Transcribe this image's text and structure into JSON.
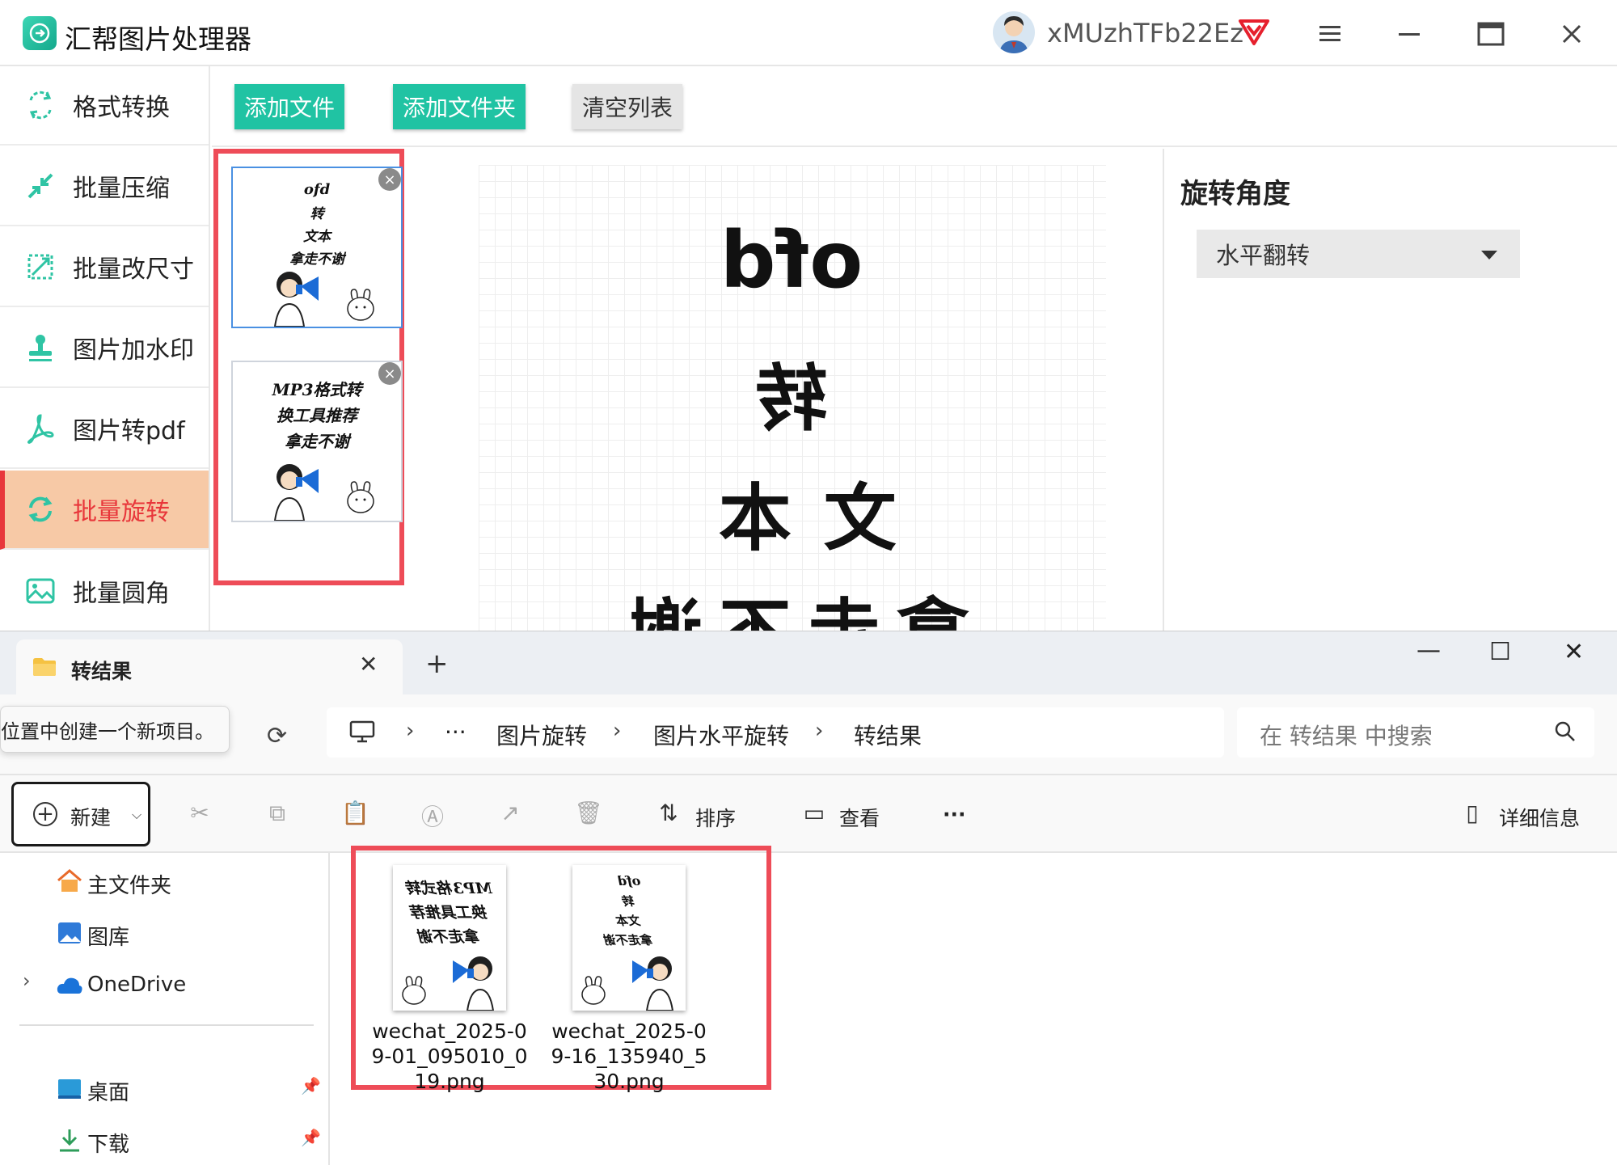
{
  "app": {
    "title": "汇帮图片处理器",
    "user_name": "xMUzhTFb22Ez",
    "buttons": {
      "add_file": "添加文件",
      "add_folder": "添加文件夹",
      "clear_list": "清空列表"
    },
    "sidebar": [
      {
        "label": "格式转换",
        "icon": "format-convert-icon"
      },
      {
        "label": "批量压缩",
        "icon": "compress-icon"
      },
      {
        "label": "批量改尺寸",
        "icon": "resize-icon"
      },
      {
        "label": "图片加水印",
        "icon": "watermark-icon"
      },
      {
        "label": "图片转pdf",
        "icon": "pdf-icon"
      },
      {
        "label": "批量旋转",
        "icon": "rotate-icon",
        "active": true
      },
      {
        "label": "批量圆角",
        "icon": "rounded-corner-icon"
      }
    ],
    "thumbnails": [
      {
        "lines": [
          "ofd",
          "转",
          "文本",
          "拿走不谢"
        ]
      },
      {
        "lines": [
          "MP3格式转",
          "换工具推荐",
          "拿走不谢"
        ]
      }
    ],
    "preview": {
      "lines": [
        "ofd",
        "转",
        "文本",
        "拿走不谢"
      ]
    },
    "rotate": {
      "label": "旋转角度",
      "selected": "水平翻转"
    },
    "accent": "#20c3a3",
    "active_color": "#e8373b",
    "highlight_border": "#ee4c58"
  },
  "explorer": {
    "tab_title": "转结果",
    "tooltip": "位置中创建一个新项目。",
    "breadcrumb": [
      "图片旋转",
      "图片水平旋转",
      "转结果"
    ],
    "ellipsis": "···",
    "search_placeholder": "在 转结果 中搜索",
    "new_label": "新建",
    "sort_label": "排序",
    "view_label": "查看",
    "more_label": "···",
    "details_label": "详细信息",
    "nav": [
      {
        "label": "主文件夹",
        "icon": "home-icon"
      },
      {
        "label": "图库",
        "icon": "gallery-icon"
      },
      {
        "label": "OneDrive",
        "icon": "onedrive-icon"
      },
      {
        "label": "桌面",
        "icon": "desktop-icon"
      },
      {
        "label": "下载",
        "icon": "download-icon"
      }
    ],
    "files": [
      {
        "name": "wechat_2025-09-01_095010_019.png",
        "lines": [
          "MP3格式转",
          "换工具推荐",
          "拿走不谢"
        ]
      },
      {
        "name": "wechat_2025-09-16_135940_530.png",
        "lines": [
          "ofd",
          "转",
          "文本",
          "拿走不谢"
        ]
      }
    ]
  }
}
